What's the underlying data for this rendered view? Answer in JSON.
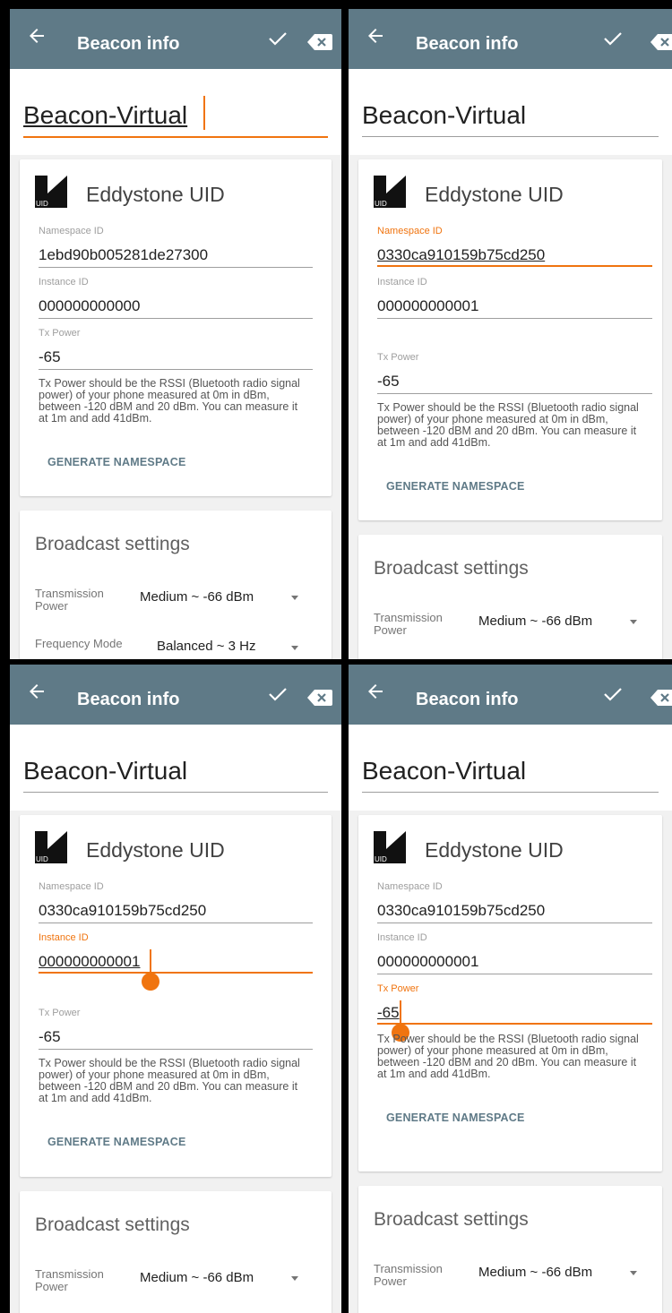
{
  "app_bar": {
    "title": "Beacon info"
  },
  "beacon_name": "Beacon-Virtual",
  "card": {
    "title": "Eddystone UID",
    "logo_text": "UID",
    "namespace_label": "Namespace ID",
    "instance_label": "Instance ID",
    "tx_label": "Tx Power",
    "tx_help": "Tx Power should be the RSSI (Bluetooth radio signal power) of your phone measured at 0m in dBm, between -120 dBM and 20 dBm. You can measure it at 1m and add 41dBm.",
    "generate_label": "GENERATE NAMESPACE"
  },
  "broadcast": {
    "title": "Broadcast settings",
    "transmission_label": "Transmission Power",
    "transmission_value": "Medium ~ -66 dBm",
    "frequency_label": "Frequency Mode",
    "frequency_value": "Balanced ~ 3 Hz"
  },
  "screens": [
    {
      "namespace_id": "1ebd90b005281de27300",
      "instance_id": "000000000000",
      "tx_power": "-65",
      "focused": "name"
    },
    {
      "namespace_id": "0330ca910159b75cd250",
      "instance_id": "000000000001",
      "tx_power": "-65",
      "focused": "namespace"
    },
    {
      "namespace_id": "0330ca910159b75cd250",
      "instance_id": "000000000001",
      "tx_power": "-65",
      "focused": "instance"
    },
    {
      "namespace_id": "0330ca910159b75cd250",
      "instance_id": "000000000001",
      "tx_power": "-65",
      "focused": "tx_power"
    }
  ],
  "colors": {
    "app_bar": "#5f7a87",
    "accent": "#f0740f",
    "background": "#f1f1f1"
  }
}
